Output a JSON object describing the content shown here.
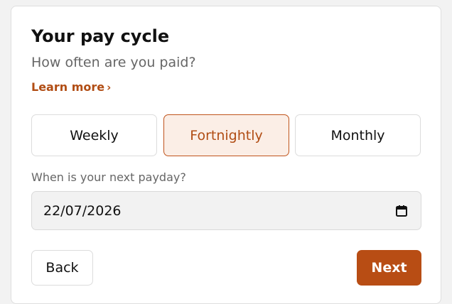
{
  "header": {
    "title": "Your pay cycle",
    "subtitle": "How often are you paid?",
    "learn_more_label": "Learn more",
    "learn_more_chevron": "›"
  },
  "frequency": {
    "selected": "Fortnightly",
    "options": [
      {
        "label": "Weekly",
        "selected": false
      },
      {
        "label": "Fortnightly",
        "selected": true
      },
      {
        "label": "Monthly",
        "selected": false
      }
    ]
  },
  "next_payday": {
    "label": "When is your next payday?",
    "value": "22/07/2026",
    "icon": "calendar-icon"
  },
  "footer": {
    "back_label": "Back",
    "next_label": "Next"
  },
  "colors": {
    "accent": "#b84d14",
    "accent_text": "#b14d14",
    "selected_bg": "#fbeee6",
    "selected_border": "#c0541c"
  }
}
